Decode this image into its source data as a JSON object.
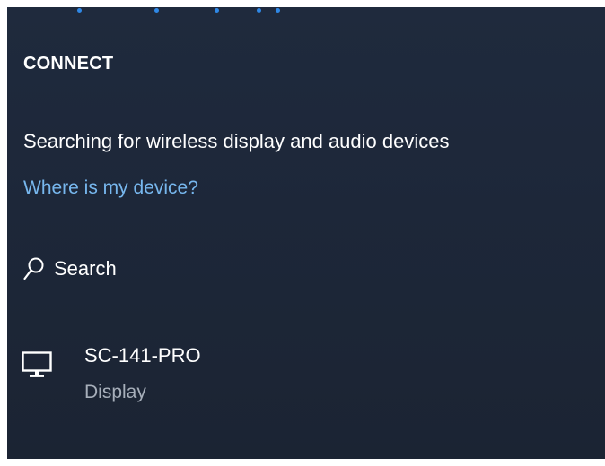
{
  "panel": {
    "title": "CONNECT",
    "status_text": "Searching for wireless display and audio devices",
    "help_link": "Where is my device?",
    "search_label": "Search",
    "search_icon": "search-icon"
  },
  "devices": [
    {
      "name": "SC-141-PRO",
      "type": "Display",
      "icon": "monitor-icon"
    }
  ],
  "colors": {
    "background": "#1d2739",
    "link": "#77b7ee",
    "progress": "#2f88e6",
    "secondary_text": "#a7afba"
  }
}
